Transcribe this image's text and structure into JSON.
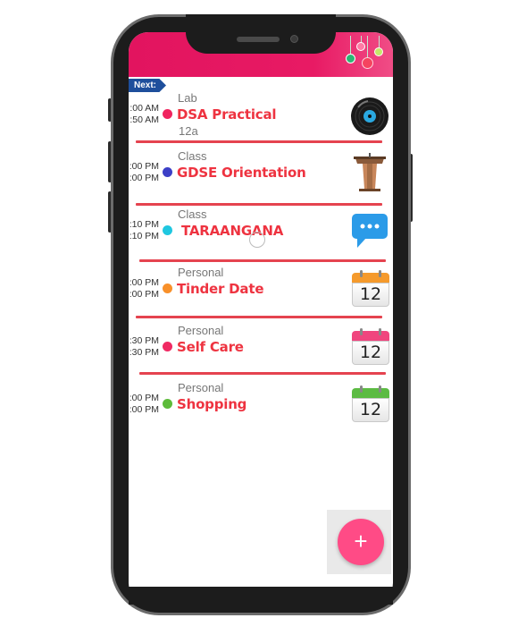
{
  "app": {
    "accent": "#e2145f",
    "fab_color": "#ff4b86"
  },
  "next_badge": "Next:",
  "events": [
    {
      "start": ":00 AM",
      "end": ":50 AM",
      "category": "Lab",
      "title": "DSA Practical",
      "room": "12a",
      "dot_color": "#f0245f",
      "icon": "vinyl-record-icon"
    },
    {
      "start": ":00 PM",
      "end": ":00 PM",
      "category": "Class",
      "title": "GDSE Orientation",
      "room": "",
      "dot_color": "#3c3fc7",
      "icon": "podium-icon"
    },
    {
      "start": ":10 PM",
      "end": ":10 PM",
      "category": "Class",
      "title": " TARAANGANA",
      "room": "",
      "dot_color": "#1fc7e0",
      "icon": "chat-bubble-icon"
    },
    {
      "start": ":00 PM",
      "end": ":00 PM",
      "category": "Personal",
      "title": "Tinder Date",
      "room": "",
      "dot_color": "#f8902a",
      "icon": "calendar-orange-icon",
      "cal_text": "12"
    },
    {
      "start": ":30 PM",
      "end": ":30 PM",
      "category": "Personal",
      "title": "Self Care",
      "room": "",
      "dot_color": "#f02a63",
      "icon": "calendar-pink-icon",
      "cal_text": "12"
    },
    {
      "start": ":00 PM",
      "end": ":00 PM",
      "category": "Personal",
      "title": "Shopping",
      "room": "",
      "dot_color": "#5dbb3a",
      "icon": "calendar-green-icon",
      "cal_text": "12"
    }
  ],
  "fab": {
    "label": "+"
  }
}
